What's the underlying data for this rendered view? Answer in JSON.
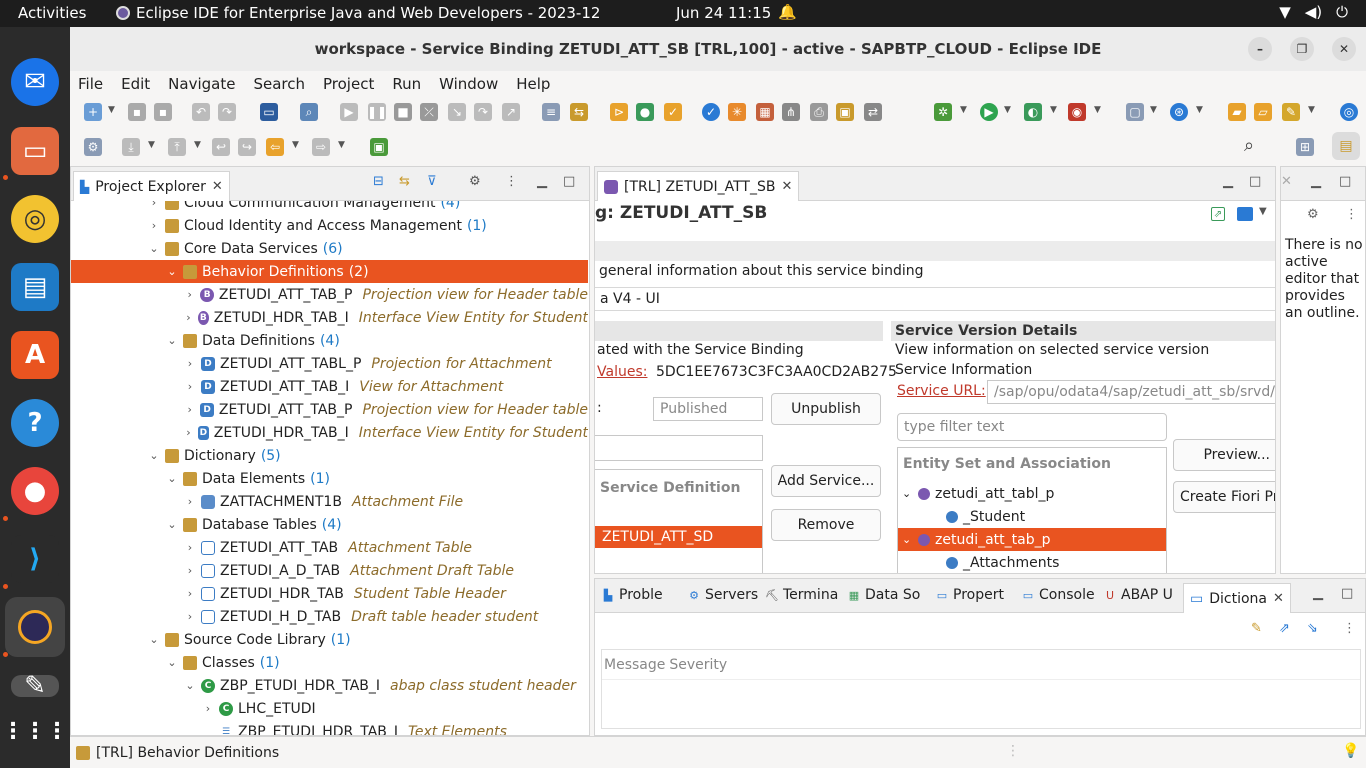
{
  "topbar": {
    "activities": "Activities",
    "app_name": "Eclipse IDE for Enterprise Java and Web Developers - 2023-12",
    "clock": "Jun 24  11:15"
  },
  "window": {
    "title": "workspace - Service Binding ZETUDI_ATT_SB [TRL,100] - active - SAPBTP_CLOUD - Eclipse IDE"
  },
  "menu": [
    "File",
    "Edit",
    "Navigate",
    "Search",
    "Project",
    "Run",
    "Window",
    "Help"
  ],
  "project_explorer": {
    "tab_label": "Project Explorer",
    "rows": [
      {
        "indent": 0,
        "arrow": "›",
        "icon": "pkg",
        "label": "Cloud Communication Management",
        "count": "(4)",
        "desc": "",
        "selected": false
      },
      {
        "indent": 0,
        "arrow": "›",
        "icon": "pkg",
        "label": "Cloud Identity and Access Management",
        "count": "(1)",
        "desc": "",
        "selected": false
      },
      {
        "indent": 0,
        "arrow": "⌄",
        "icon": "pkg",
        "label": "Core Data Services",
        "count": "(6)",
        "desc": "",
        "selected": false
      },
      {
        "indent": 1,
        "arrow": "⌄",
        "icon": "pkg",
        "label": "Behavior Definitions",
        "count": "(2)",
        "desc": "",
        "selected": true
      },
      {
        "indent": 2,
        "arrow": "›",
        "icon": "bdef",
        "label": "ZETUDI_ATT_TAB_P",
        "count": "",
        "desc": "Projection view for Header table",
        "selected": false
      },
      {
        "indent": 2,
        "arrow": "›",
        "icon": "bdef",
        "label": "ZETUDI_HDR_TAB_I",
        "count": "",
        "desc": "Interface View Entity for Student",
        "selected": false
      },
      {
        "indent": 1,
        "arrow": "⌄",
        "icon": "pkg",
        "label": "Data Definitions",
        "count": "(4)",
        "desc": "",
        "selected": false
      },
      {
        "indent": 2,
        "arrow": "›",
        "icon": "ddef",
        "label": "ZETUDI_ATT_TABL_P",
        "count": "",
        "desc": "Projection for Attachment",
        "selected": false
      },
      {
        "indent": 2,
        "arrow": "›",
        "icon": "ddef",
        "label": "ZETUDI_ATT_TAB_I",
        "count": "",
        "desc": "View for Attachment",
        "selected": false
      },
      {
        "indent": 2,
        "arrow": "›",
        "icon": "ddef",
        "label": "ZETUDI_ATT_TAB_P",
        "count": "",
        "desc": "Projection view for Header table",
        "selected": false
      },
      {
        "indent": 2,
        "arrow": "›",
        "icon": "ddef",
        "label": "ZETUDI_HDR_TAB_I",
        "count": "",
        "desc": "Interface View Entity for Student",
        "selected": false
      },
      {
        "indent": 0,
        "arrow": "⌄",
        "icon": "pkg",
        "label": "Dictionary",
        "count": "(5)",
        "desc": "",
        "selected": false
      },
      {
        "indent": 1,
        "arrow": "⌄",
        "icon": "pkg",
        "label": "Data Elements",
        "count": "(1)",
        "desc": "",
        "selected": false
      },
      {
        "indent": 2,
        "arrow": "›",
        "icon": "del",
        "label": "ZATTACHMENT1B",
        "count": "",
        "desc": "Attachment File",
        "selected": false
      },
      {
        "indent": 1,
        "arrow": "⌄",
        "icon": "pkg",
        "label": "Database Tables",
        "count": "(4)",
        "desc": "",
        "selected": false
      },
      {
        "indent": 2,
        "arrow": "›",
        "icon": "tbl",
        "label": "ZETUDI_ATT_TAB",
        "count": "",
        "desc": "Attachment Table",
        "selected": false
      },
      {
        "indent": 2,
        "arrow": "›",
        "icon": "tbl",
        "label": "ZETUDI_A_D_TAB",
        "count": "",
        "desc": "Attachment Draft Table",
        "selected": false
      },
      {
        "indent": 2,
        "arrow": "›",
        "icon": "tbl",
        "label": "ZETUDI_HDR_TAB",
        "count": "",
        "desc": "Student Table Header",
        "selected": false
      },
      {
        "indent": 2,
        "arrow": "›",
        "icon": "tbl",
        "label": "ZETUDI_H_D_TAB",
        "count": "",
        "desc": "Draft table header student",
        "selected": false
      },
      {
        "indent": 0,
        "arrow": "⌄",
        "icon": "pkg",
        "label": "Source Code Library",
        "count": "(1)",
        "desc": "",
        "selected": false
      },
      {
        "indent": 1,
        "arrow": "⌄",
        "icon": "pkg",
        "label": "Classes",
        "count": "(1)",
        "desc": "",
        "selected": false
      },
      {
        "indent": 2,
        "arrow": "⌄",
        "icon": "cls",
        "label": "ZBP_ETUDI_HDR_TAB_I",
        "count": "",
        "desc": "abap class student header",
        "selected": false
      },
      {
        "indent": 3,
        "arrow": "›",
        "icon": "cls",
        "label": "LHC_ETUDI",
        "count": "",
        "desc": "",
        "selected": false
      },
      {
        "indent": 3,
        "arrow": "",
        "icon": "txt",
        "label": "ZBP_ETUDI_HDR_TAB_I",
        "count": "",
        "desc": "Text Elements",
        "selected": false
      }
    ]
  },
  "editor": {
    "tab_label": "[TRL] ZETUDI_ATT_SB",
    "title": "g: ZETUDI_ATT_SB",
    "general_info": "general information about this service binding",
    "binding_type": "a V4 - UI",
    "left_section_text": "ated with the Service Binding",
    "values_label": "Values:",
    "values_value": "5DC1EE7673C3FC3AA0CD2AB275",
    "colon_label": ":",
    "published_value": "Published",
    "unpublish_btn": "Unpublish",
    "service_definition_header": "Service Definition",
    "service_definition_row": "ZETUDI_ATT_SD",
    "add_service_btn": "Add Service...",
    "remove_btn": "Remove",
    "svd_header": "Service Version Details",
    "svd_desc": "View information on selected service version",
    "svc_info": "Service Information",
    "service_url_label": "Service URL:",
    "service_url_value": "/sap/opu/odata4/sap/zetudi_att_sb/srvd/s",
    "filter_placeholder": "type filter text",
    "entity_header": "Entity Set and Association",
    "entities": [
      {
        "indent": 0,
        "arrow": "⌄",
        "label": "zetudi_att_tabl_p",
        "selected": false
      },
      {
        "indent": 1,
        "arrow": "",
        "label": "_Student",
        "selected": false
      },
      {
        "indent": 0,
        "arrow": "⌄",
        "label": "zetudi_att_tab_p",
        "selected": true
      },
      {
        "indent": 1,
        "arrow": "",
        "label": "_Attachments",
        "selected": false
      }
    ],
    "preview_btn": "Preview...",
    "create_fiori_btn": "Create Fiori Pr"
  },
  "outline": {
    "message": "There is no active editor that provides an outline."
  },
  "bottom": {
    "tabs": [
      {
        "label": "Proble",
        "icon": "problems-icon"
      },
      {
        "label": "Servers",
        "icon": "servers-icon"
      },
      {
        "label": "Termina",
        "icon": "terminal-icon"
      },
      {
        "label": "Data So",
        "icon": "data-source-icon"
      },
      {
        "label": "Propert",
        "icon": "properties-icon"
      },
      {
        "label": "Console",
        "icon": "console-icon"
      },
      {
        "label": "ABAP U",
        "icon": "abap-unit-icon"
      },
      {
        "label": "Dictiona",
        "icon": "dictionary-icon"
      }
    ],
    "col_message": "Message",
    "col_severity": "Severity"
  },
  "status": {
    "text": "[TRL] Behavior Definitions"
  },
  "colors": {
    "accent": "#e95420",
    "link": "#1e7ac6",
    "desc": "#8c6b2a"
  }
}
